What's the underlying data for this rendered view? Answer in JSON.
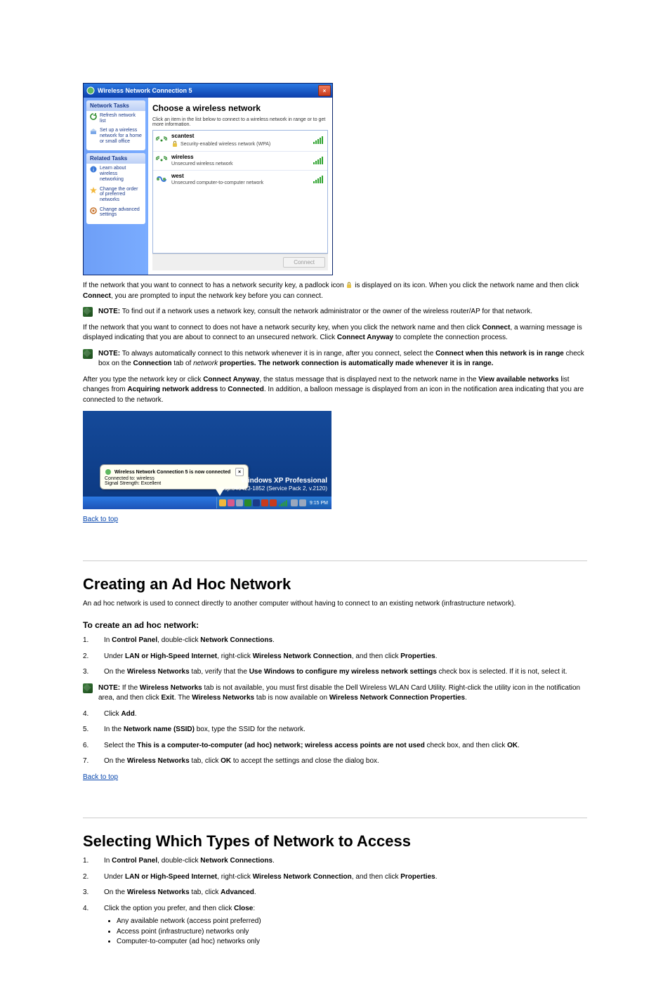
{
  "dialog": {
    "title": "Wireless Network Connection 5",
    "tasks_header": "Network Tasks",
    "tasks": [
      {
        "label": "Refresh network list"
      },
      {
        "label": "Set up a wireless network for a home or small office"
      }
    ],
    "related_header": "Related Tasks",
    "related": [
      {
        "label": "Learn about wireless networking"
      },
      {
        "label": "Change the order of preferred networks"
      },
      {
        "label": "Change advanced settings"
      }
    ],
    "heading": "Choose a wireless network",
    "hint": "Click an item in the list below to connect to a wireless network in range or to get more information.",
    "networks": [
      {
        "name": "scantest",
        "desc": "Security-enabled wireless network (WPA)",
        "secured": true,
        "type": "ap"
      },
      {
        "name": "wireless",
        "desc": "Unsecured wireless network",
        "secured": false,
        "type": "ap"
      },
      {
        "name": "west",
        "desc": "Unsecured computer-to-computer network",
        "secured": false,
        "type": "adhoc"
      }
    ],
    "connect_label": "Connect"
  },
  "para1_a": "If the network that you want to connect to has a network security key, a padlock icon ",
  "para1_b": " is displayed on its icon. When you click the network name and then click ",
  "para1_c": ", you are prompted to input the network key before you can connect.",
  "connect_bold": "Connect",
  "note1_label": "NOTE:",
  "note1_text": "To find out if a network uses a network key, consult the network administrator or the owner of the wireless router/AP for that network.",
  "para2": "If the network that you want to connect to does not have a network security key, when you click the network name and then click ",
  "para2_b": ", a warning message is displayed indicating that you are about to connect to an unsecured network. Click ",
  "cab": "Connect Anyway",
  "para2_c": " to complete the connection process.",
  "note2_label": "NOTE:",
  "note2_text": "To always automatically connect to this network whenever it is in range, after you connect, select the ",
  "note2_chk": "Connect when this network is in range",
  "note2_tail": " check box on the ",
  "note2_tab": "Connection",
  "note2_of": " tab of ",
  "note2_props": "network",
  "note2_props2": " properties. The network connection is automatically made whenever it is in range.",
  "para3_a": "After you type the network key or click ",
  "para3_b": ", the status message that is displayed next to the network name in the ",
  "viewwnets": "View available networks",
  "para3_c": " list changes from ",
  "acq": "Acquiring network address",
  "para3_d": " to ",
  "conn": "Connected",
  "para3_e": ". In addition, a balloon message is displayed from an icon in the notification area indicating that you are connected to the network.",
  "balloon": {
    "title": "Wireless Network Connection 5 is now connected",
    "line1": "Connected to: wireless",
    "line2": "Signal Strength: Excellent"
  },
  "desktop": {
    "os": "Windows XP Professional",
    "build": "xpsp.040423-1852 (Service Pack 2, v.2120)",
    "clock": "9:15 PM"
  },
  "back_top": "Back to top",
  "section2_title": "Creating an Ad Hoc Network",
  "sec2_intro": "An ad hoc network is used to connect directly to another computer without having to connect to an existing network (infrastructure network).",
  "sec2_sub": "To create an ad hoc network:",
  "s1_num": "1.",
  "s1_a": "In ",
  "cp": "Control Panel",
  "s1_b": ", double-click ",
  "nc": "Network Connections",
  "s1_c": ".",
  "s2_num": "2.",
  "s2_a": "Under ",
  "lan": "LAN or High-Speed Internet",
  "s2_b": ", right-click ",
  "wnc": "Wireless Network Connection",
  "s2_c": ", and then click ",
  "props": "Properties",
  "s2_d": ".",
  "s3_num": "3.",
  "s3_a": "On the ",
  "wntab": "Wireless Networks",
  "s3_b": " tab, verify that the ",
  "uwchk": "Use Windows to configure my wireless network settings",
  "s3_c": " check box is selected. If it is not, select it.",
  "note3_label": "NOTE:",
  "note3_text": "If the ",
  "note3_b": " tab is not available, you must first disable the Dell Wireless WLAN Card Utility. Right-click the utility icon in the notification area, and then click ",
  "exit": "Exit",
  "note3_c": ". The ",
  "note3_d": " tab is now available on ",
  "wncp": "Wireless Network Connection Properties",
  "note3_e": ".",
  "s4_num": "4.",
  "s4_a": "Click ",
  "add": "Add",
  "s4_b": ".",
  "s5_num": "5.",
  "s5_a": "In the ",
  "nn": "Network name (SSID)",
  "s5_b": " box, type the SSID for the network.",
  "s6_num": "6.",
  "s6_a": "Select the ",
  "adhoc_chk": "This is a computer-to-computer (ad hoc) network; wireless access points are not used",
  "s6_b": " check box, and then click ",
  "ok": "OK",
  "s6_c": ".",
  "s7_num": "7.",
  "s7_a": "On the ",
  "s7_b": " tab, click ",
  "s7_c": " to accept the settings and close the dialog box.",
  "back_top2": "Back to top",
  "section3_title": "Selecting Which Types of Network to Access",
  "s3p1_num": "1.",
  "s3p1_a": "In ",
  "s3p1_b": ", double-click ",
  "s3p1_c": ".",
  "s3p2_num": "2.",
  "s3p2_a": "Under ",
  "s3p2_b": ", right-click ",
  "s3p2_c": ", and then click ",
  "s3p2_d": ".",
  "s3p3_num": "3.",
  "s3p3_a": "On the ",
  "s3p3_b": " tab, click ",
  "adv": "Advanced",
  "s3p3_c": ".",
  "s3p4_num": "4.",
  "s3p4_a": "Click the option you prefer, and then click ",
  "close": "Close",
  "s3p4_b": ":",
  "opt1": "Any available network (access point preferred)",
  "opt2": "Access point (infrastructure) networks only",
  "opt3": "Computer-to-computer (ad hoc) networks only"
}
